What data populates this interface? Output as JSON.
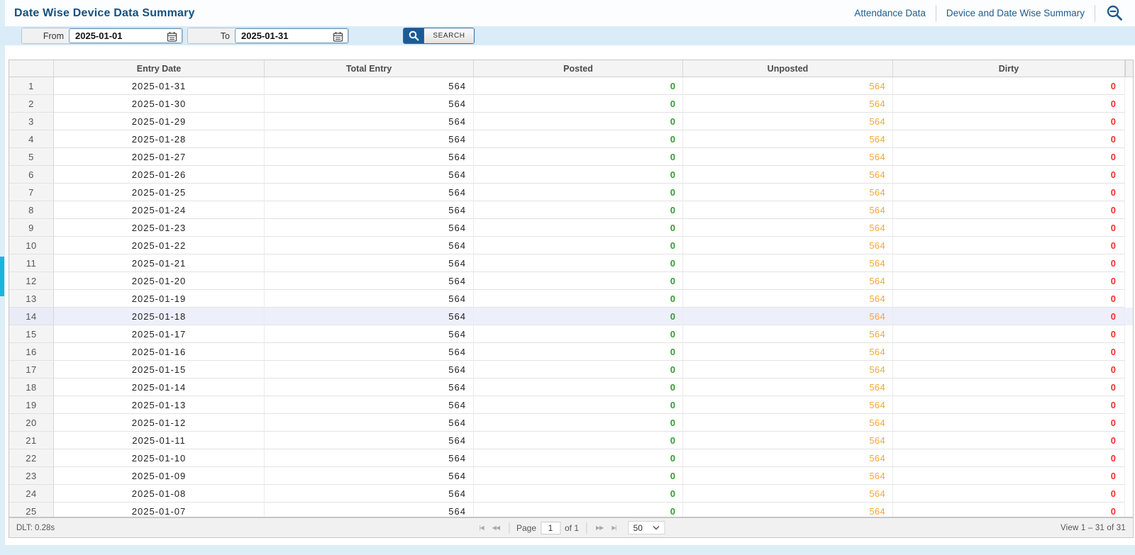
{
  "header": {
    "title": "Date Wise Device Data Summary",
    "links": [
      {
        "label": "Attendance Data"
      },
      {
        "label": "Device and Date Wise Summary"
      }
    ],
    "zoom_icon": "magnifier-minus (zoom-out)"
  },
  "filter": {
    "from_label": "From",
    "from_value": "2025-01-01",
    "to_label": "To",
    "to_value": "2025-01-31",
    "search_icon": "magnifier",
    "search_label": "SEARCH",
    "calendar_icon": "calendar"
  },
  "table": {
    "columns": {
      "num": "",
      "date": "Entry Date",
      "total": "Total Entry",
      "posted": "Posted",
      "unposted": "Unposted",
      "dirty": "Dirty"
    },
    "rows": [
      {
        "n": "1",
        "date": "2025-01-31",
        "total": "564",
        "posted": "0",
        "unposted": "564",
        "dirty": "0"
      },
      {
        "n": "2",
        "date": "2025-01-30",
        "total": "564",
        "posted": "0",
        "unposted": "564",
        "dirty": "0"
      },
      {
        "n": "3",
        "date": "2025-01-29",
        "total": "564",
        "posted": "0",
        "unposted": "564",
        "dirty": "0"
      },
      {
        "n": "4",
        "date": "2025-01-28",
        "total": "564",
        "posted": "0",
        "unposted": "564",
        "dirty": "0"
      },
      {
        "n": "5",
        "date": "2025-01-27",
        "total": "564",
        "posted": "0",
        "unposted": "564",
        "dirty": "0"
      },
      {
        "n": "6",
        "date": "2025-01-26",
        "total": "564",
        "posted": "0",
        "unposted": "564",
        "dirty": "0"
      },
      {
        "n": "7",
        "date": "2025-01-25",
        "total": "564",
        "posted": "0",
        "unposted": "564",
        "dirty": "0"
      },
      {
        "n": "8",
        "date": "2025-01-24",
        "total": "564",
        "posted": "0",
        "unposted": "564",
        "dirty": "0"
      },
      {
        "n": "9",
        "date": "2025-01-23",
        "total": "564",
        "posted": "0",
        "unposted": "564",
        "dirty": "0"
      },
      {
        "n": "10",
        "date": "2025-01-22",
        "total": "564",
        "posted": "0",
        "unposted": "564",
        "dirty": "0"
      },
      {
        "n": "11",
        "date": "2025-01-21",
        "total": "564",
        "posted": "0",
        "unposted": "564",
        "dirty": "0"
      },
      {
        "n": "12",
        "date": "2025-01-20",
        "total": "564",
        "posted": "0",
        "unposted": "564",
        "dirty": "0"
      },
      {
        "n": "13",
        "date": "2025-01-19",
        "total": "564",
        "posted": "0",
        "unposted": "564",
        "dirty": "0"
      },
      {
        "n": "14",
        "date": "2025-01-18",
        "total": "564",
        "posted": "0",
        "unposted": "564",
        "dirty": "0",
        "highlight": true
      },
      {
        "n": "15",
        "date": "2025-01-17",
        "total": "564",
        "posted": "0",
        "unposted": "564",
        "dirty": "0"
      },
      {
        "n": "16",
        "date": "2025-01-16",
        "total": "564",
        "posted": "0",
        "unposted": "564",
        "dirty": "0"
      },
      {
        "n": "17",
        "date": "2025-01-15",
        "total": "564",
        "posted": "0",
        "unposted": "564",
        "dirty": "0"
      },
      {
        "n": "18",
        "date": "2025-01-14",
        "total": "564",
        "posted": "0",
        "unposted": "564",
        "dirty": "0"
      },
      {
        "n": "19",
        "date": "2025-01-13",
        "total": "564",
        "posted": "0",
        "unposted": "564",
        "dirty": "0"
      },
      {
        "n": "20",
        "date": "2025-01-12",
        "total": "564",
        "posted": "0",
        "unposted": "564",
        "dirty": "0"
      },
      {
        "n": "21",
        "date": "2025-01-11",
        "total": "564",
        "posted": "0",
        "unposted": "564",
        "dirty": "0"
      },
      {
        "n": "22",
        "date": "2025-01-10",
        "total": "564",
        "posted": "0",
        "unposted": "564",
        "dirty": "0"
      },
      {
        "n": "23",
        "date": "2025-01-09",
        "total": "564",
        "posted": "0",
        "unposted": "564",
        "dirty": "0"
      },
      {
        "n": "24",
        "date": "2025-01-08",
        "total": "564",
        "posted": "0",
        "unposted": "564",
        "dirty": "0"
      },
      {
        "n": "25",
        "date": "2025-01-07",
        "total": "564",
        "posted": "0",
        "unposted": "564",
        "dirty": "0"
      }
    ]
  },
  "footer": {
    "dlt": "DLT: 0.28s",
    "pager": {
      "first_icon": "|◀",
      "prev_icon": "◀◀",
      "next_icon": "▶▶",
      "last_icon": "▶|",
      "page_label": "Page",
      "page_value": "1",
      "of_label": "of 1",
      "page_size": "50"
    },
    "view_label": "View 1 – 31 of 31"
  },
  "colors": {
    "accent_blue": "#15517f",
    "link_blue": "#1d5c90",
    "filter_bg": "#d9ecf8",
    "green": "#2da12d",
    "orange": "#f5a733",
    "red": "#f03030",
    "cyan_tab": "#18b7d8",
    "highlight_row": "#edf0fb",
    "page_strip": "#ddeef7"
  }
}
